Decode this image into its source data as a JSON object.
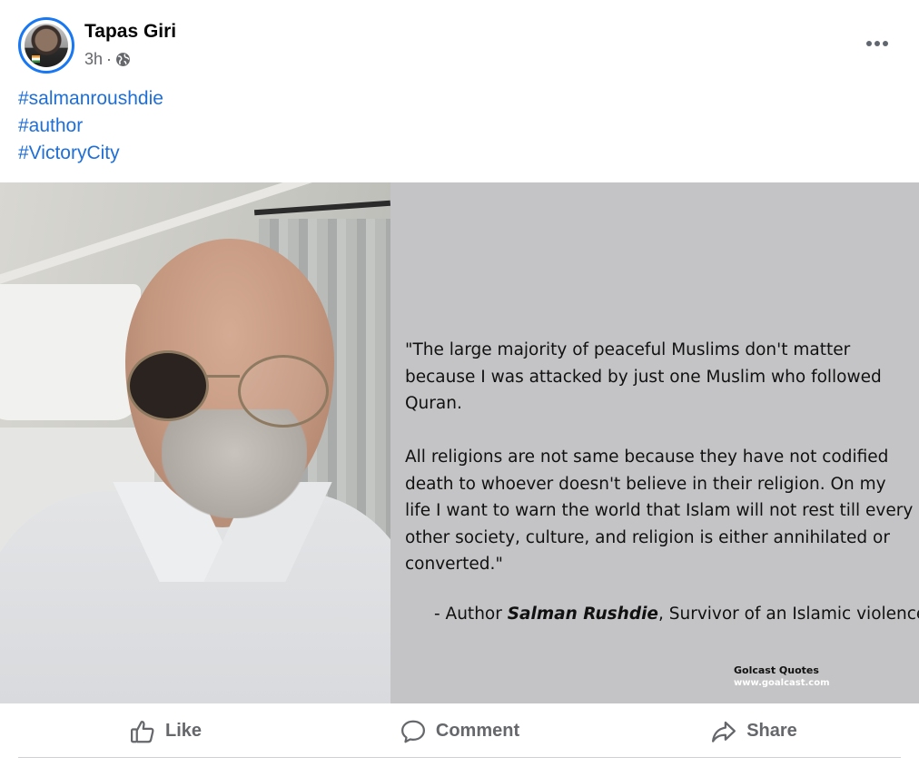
{
  "post": {
    "author": "Tapas Giri",
    "time": "3h",
    "time_separator": "·",
    "audience_icon": "globe-icon",
    "more_icon": "more-options-icon",
    "hashtags": [
      "#salmanroushdie",
      "#author",
      "#VictoryCity"
    ],
    "image": {
      "quote_paragraphs": [
        "\"The large majority of peaceful Muslims don't matter because I was attacked by just one Muslim who followed Quran.",
        "All religions are not same because they have not codified death to whoever doesn't believe in their religion. On my life I want to warn the world that Islam will not rest till every other society, culture, and religion is either annihilated or converted.\""
      ],
      "attribution_prefix": "- Author ",
      "attribution_name": "Salman Rushdie",
      "attribution_suffix": ", Survivor of an Islamic violence",
      "brand_name": "Golcast Quotes",
      "brand_url": "www.goalcast.com"
    },
    "actions": [
      {
        "label": "Like",
        "icon": "thumbs-up-icon"
      },
      {
        "label": "Comment",
        "icon": "speech-bubble-icon"
      },
      {
        "label": "Share",
        "icon": "share-arrow-icon"
      }
    ]
  },
  "colors": {
    "accent": "#1877f2",
    "hashtag": "#1f6fd8",
    "secondary_text": "#65676b",
    "quote_background": "#c4c4c6"
  }
}
